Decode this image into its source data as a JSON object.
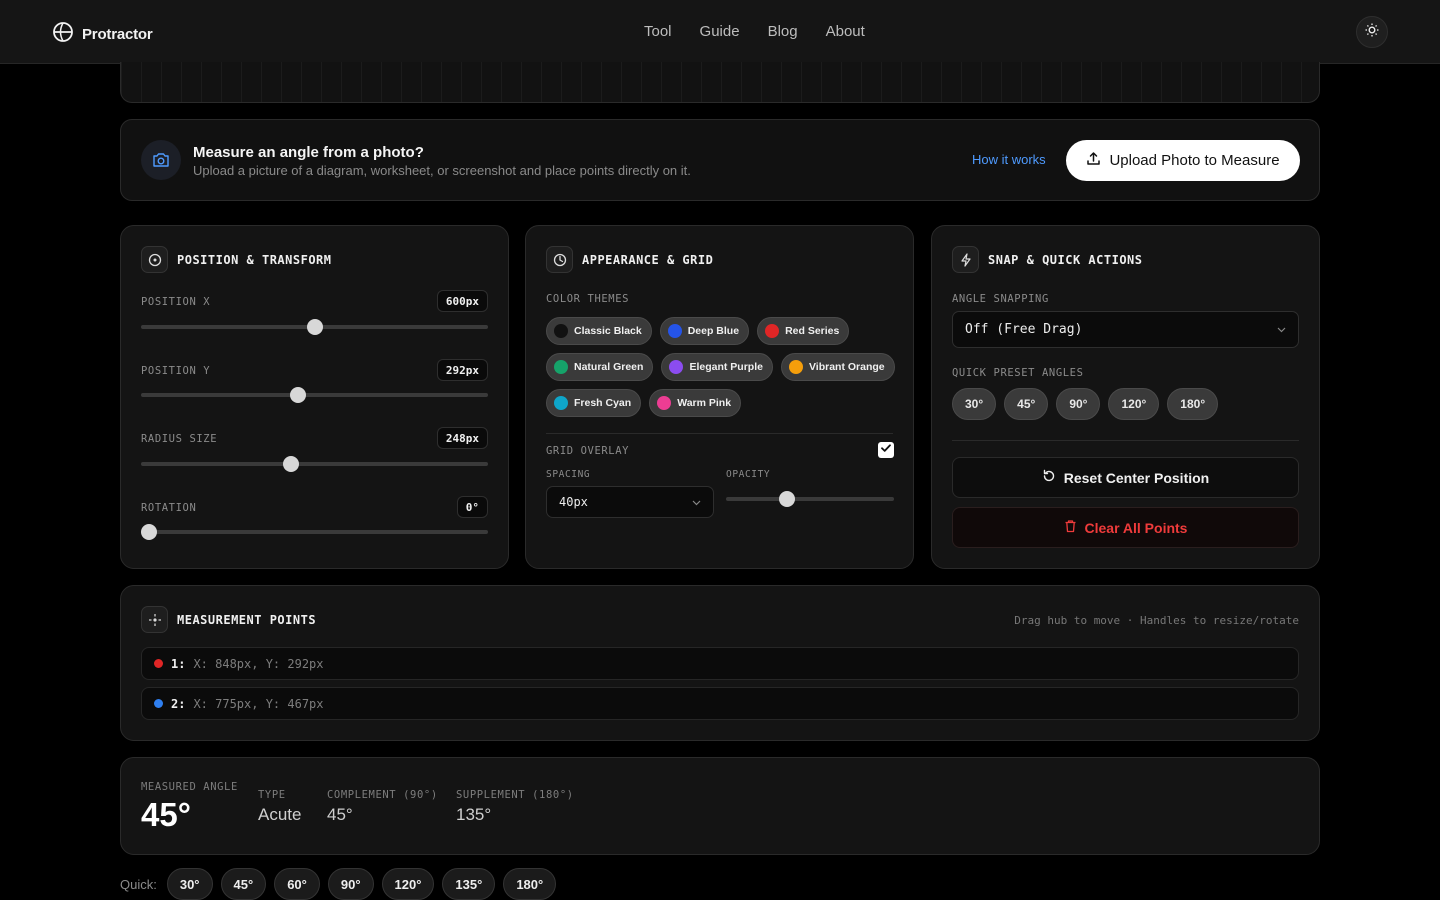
{
  "header": {
    "brand": "Protractor",
    "nav": [
      "Tool",
      "Guide",
      "Blog",
      "About"
    ]
  },
  "upload": {
    "title": "Measure an angle from a photo?",
    "subtitle": "Upload a picture of a diagram, worksheet, or screenshot and place points directly on it.",
    "how_link": "How it works",
    "button": "Upload Photo to Measure"
  },
  "position_panel": {
    "title": "POSITION & TRANSFORM",
    "sliders": [
      {
        "label": "POSITION X",
        "value": "600px",
        "fraction": 0.5
      },
      {
        "label": "POSITION Y",
        "value": "292px",
        "fraction": 0.45
      },
      {
        "label": "RADIUS SIZE",
        "value": "248px",
        "fraction": 0.43
      },
      {
        "label": "ROTATION",
        "value": "0°",
        "fraction": 0.0
      }
    ]
  },
  "appearance_panel": {
    "title": "APPEARANCE & GRID",
    "color_themes_label": "COLOR THEMES",
    "themes": [
      {
        "name": "Classic Black",
        "color": "#111111"
      },
      {
        "name": "Deep Blue",
        "color": "#2554e8"
      },
      {
        "name": "Red Series",
        "color": "#e02626"
      },
      {
        "name": "Natural Green",
        "color": "#16a36a"
      },
      {
        "name": "Elegant Purple",
        "color": "#8b4cf0"
      },
      {
        "name": "Vibrant Orange",
        "color": "#f59e0b"
      },
      {
        "name": "Fresh Cyan",
        "color": "#0ea5c9"
      },
      {
        "name": "Warm Pink",
        "color": "#ec3d93"
      }
    ],
    "grid_label": "GRID OVERLAY",
    "grid_enabled": true,
    "spacing_label": "SPACING",
    "spacing_value": "40px",
    "opacity_label": "OPACITY",
    "opacity_fraction": 0.35
  },
  "snap_panel": {
    "title": "SNAP & QUICK ACTIONS",
    "snapping_label": "ANGLE SNAPPING",
    "snapping_value": "Off (Free Drag)",
    "presets_label": "QUICK PRESET ANGLES",
    "presets": [
      "30°",
      "45°",
      "90°",
      "120°",
      "180°"
    ],
    "reset_label": "Reset Center Position",
    "clear_label": "Clear All Points"
  },
  "points": {
    "title": "MEASUREMENT POINTS",
    "hint": "Drag hub to move · Handles to resize/rotate",
    "items": [
      {
        "num": "1:",
        "coords": "X: 848px, Y: 292px",
        "color": "#e02626"
      },
      {
        "num": "2:",
        "coords": "X: 775px, Y: 467px",
        "color": "#2f7ff0"
      }
    ]
  },
  "result": {
    "measured_label": "MEASURED ANGLE",
    "measured_value": "45°",
    "type_label": "TYPE",
    "type_value": "Acute",
    "complement_label": "COMPLEMENT (90°)",
    "complement_value": "45°",
    "supplement_label": "SUPPLEMENT (180°)",
    "supplement_value": "135°"
  },
  "quick": {
    "label": "Quick:",
    "angles": [
      "30°",
      "45°",
      "60°",
      "90°",
      "120°",
      "135°",
      "180°"
    ]
  }
}
